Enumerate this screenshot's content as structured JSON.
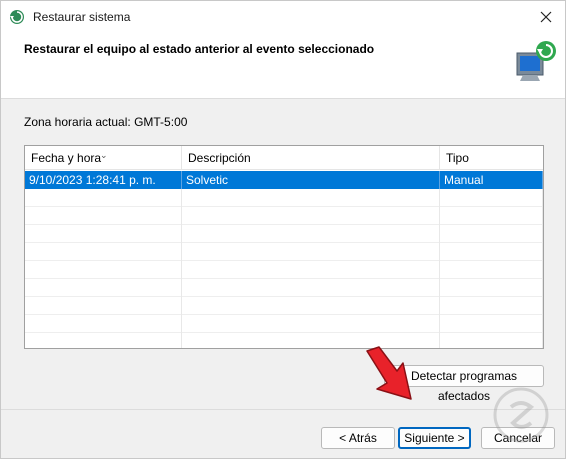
{
  "window": {
    "title": "Restaurar sistema",
    "close_label": "✕"
  },
  "header": {
    "heading": "Restaurar el equipo al estado anterior al evento seleccionado"
  },
  "timezone": {
    "label": "Zona horaria actual: GMT-5:00"
  },
  "table": {
    "columns": [
      "Fecha y hora",
      "Descripción",
      "Tipo"
    ],
    "sort_indicator": "⌄",
    "rows": [
      {
        "date": "9/10/2023 1:28:41 p. m.",
        "description": "Solvetic",
        "type": "Manual",
        "selected": true
      }
    ]
  },
  "buttons": {
    "detect": "Detectar programas afectados",
    "back": "< Atrás",
    "next": "Siguiente >",
    "cancel": "Cancelar"
  },
  "colors": {
    "selection": "#0078d7",
    "primary_border": "#0067c0",
    "arrow": "#e8222a"
  },
  "icons": {
    "app": "system-restore-icon",
    "wizard": "monitor-restore-icon",
    "pointer": "red-arrow-icon"
  }
}
